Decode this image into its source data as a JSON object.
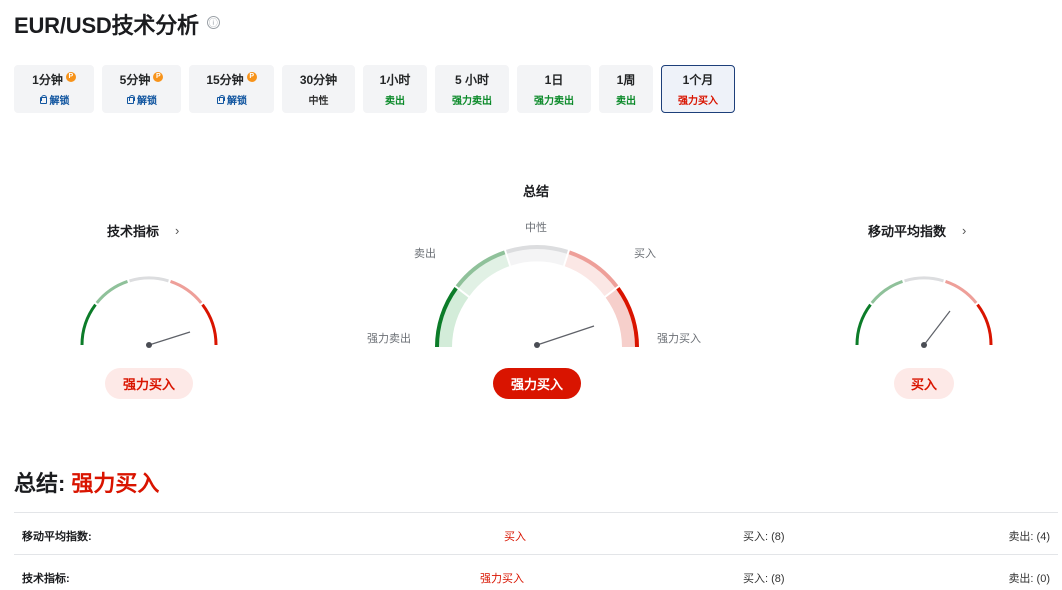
{
  "page": {
    "title": "EUR/USD技术分析",
    "info_icon": "ⓘ"
  },
  "tabs": [
    {
      "label": "1分钟",
      "sub": "解锁",
      "locked": true,
      "pro": true
    },
    {
      "label": "5分钟",
      "sub": "解锁",
      "locked": true,
      "pro": true
    },
    {
      "label": "15分钟",
      "sub": "解锁",
      "locked": true,
      "pro": true
    },
    {
      "label": "30分钟",
      "sub": "中性",
      "signal": "neutral"
    },
    {
      "label": "1小时",
      "sub": "卖出",
      "signal": "sell"
    },
    {
      "label": "5 小时",
      "sub": "强力卖出",
      "signal": "sell"
    },
    {
      "label": "1日",
      "sub": "强力卖出",
      "signal": "sell"
    },
    {
      "label": "1周",
      "sub": "卖出",
      "signal": "sell"
    },
    {
      "label": "1个月",
      "sub": "强力买入",
      "signal": "buy",
      "active": true
    }
  ],
  "gauges": {
    "technical": {
      "title": "技术指标",
      "chevron": "›",
      "result": "强力买入"
    },
    "summary": {
      "title": "总结",
      "labels": {
        "neutral": "中性",
        "sell": "卖出",
        "buy": "买入",
        "strong_sell": "强力卖出",
        "strong_buy": "强力买入"
      },
      "result": "强力买入"
    },
    "moving_avg": {
      "title": "移动平均指数",
      "chevron": "›",
      "result": "买入"
    }
  },
  "summary": {
    "label": "总结:",
    "value": "强力买入"
  },
  "table": [
    {
      "name": "移动平均指数:",
      "signal": "买入",
      "buy": "买入: (8)",
      "sell": "卖出: (4)"
    },
    {
      "name": "技术指标:",
      "signal": "强力买入",
      "buy": "买入: (8)",
      "sell": "卖出: (0)"
    }
  ],
  "colors": {
    "strong_sell": "#0c7c29",
    "sell": "#8fc19a",
    "neutral": "#dcdddf",
    "buy": "#ee9f99",
    "strong_buy": "#d91400"
  }
}
